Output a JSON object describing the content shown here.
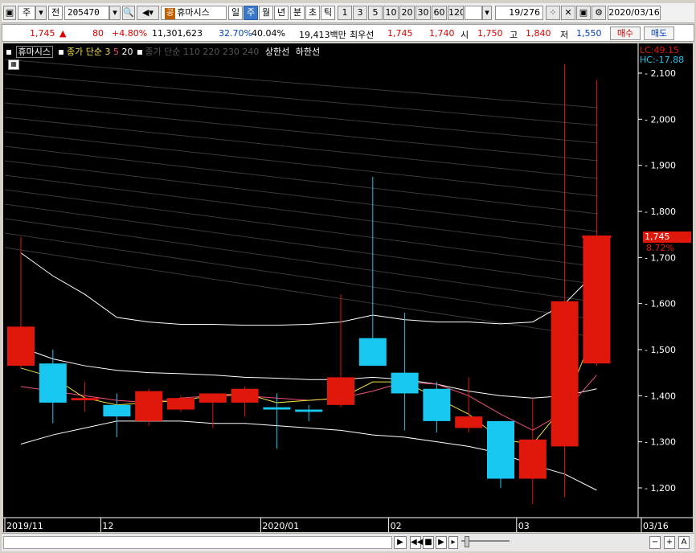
{
  "toolbar": {
    "market": "주",
    "jeon": "전",
    "code": "205470",
    "name_badge": "공",
    "name": "휴마시스",
    "periods": [
      "일",
      "주",
      "월",
      "년"
    ],
    "selected_period": "주",
    "minute_tabs": [
      "분",
      "초",
      "틱"
    ],
    "nums": [
      "1",
      "3",
      "5",
      "10",
      "20",
      "30",
      "60",
      "120"
    ],
    "count": "19",
    "total": "/276",
    "date": "2020/03/16"
  },
  "info": {
    "price": "1,745",
    "arrow": "▲",
    "change": "80",
    "pct": "+4.80%",
    "volume": "11,301,623",
    "vol_ratio": "32.70%",
    "turnover": "40.04%",
    "amount": "19,413백만",
    "best_label": "최우선",
    "ask": "1,745",
    "bid": "1,740",
    "open_label": "시",
    "open": "1,750",
    "high_label": "고",
    "high": "1,840",
    "low_label": "저",
    "low": "1,550",
    "buy": "매수",
    "sell": "매도"
  },
  "legend": {
    "name": "휴마시스",
    "ma_label": "종가 단순 3",
    "ma5": "5",
    "ma20": "20",
    "faded": "종가 단순 110 220 230 240",
    "upper": "상한선",
    "lower": "하한선"
  },
  "overlay": {
    "lc": "LC:49.15",
    "hc": "HC:-17.88",
    "price_tag": "1,745",
    "pct_tag": "8.72%"
  },
  "colors": {
    "up": "#e0180c",
    "down": "#18c8f0",
    "ma3": "#f0e040",
    "ma5": "#f05078",
    "ma20": "#ffffff",
    "axis": "#ffffff"
  },
  "chart_data": {
    "type": "candlestick",
    "yticks": [
      1200,
      1300,
      1400,
      1500,
      1600,
      1700,
      1800,
      1900,
      2000,
      2100
    ],
    "ylim": [
      1165,
      2160
    ],
    "xlabels": [
      {
        "index": 0,
        "label": "2019/11"
      },
      {
        "index": 3,
        "label": "12"
      },
      {
        "index": 8,
        "label": "2020/01"
      },
      {
        "index": 12,
        "label": "02"
      },
      {
        "index": 16,
        "label": "03"
      },
      {
        "index": 19,
        "label": "03/16"
      }
    ],
    "candles": [
      {
        "o": 1465,
        "h": 1745,
        "l": 1460,
        "c": 1550
      },
      {
        "o": 1470,
        "h": 1500,
        "l": 1340,
        "c": 1385
      },
      {
        "o": 1390,
        "h": 1430,
        "l": 1365,
        "c": 1395
      },
      {
        "o": 1380,
        "h": 1405,
        "l": 1310,
        "c": 1355
      },
      {
        "o": 1345,
        "h": 1415,
        "l": 1335,
        "c": 1410
      },
      {
        "o": 1370,
        "h": 1400,
        "l": 1365,
        "c": 1395
      },
      {
        "o": 1385,
        "h": 1405,
        "l": 1330,
        "c": 1405
      },
      {
        "o": 1385,
        "h": 1420,
        "l": 1355,
        "c": 1415
      },
      {
        "o": 1375,
        "h": 1405,
        "l": 1285,
        "c": 1370
      },
      {
        "o": 1370,
        "h": 1380,
        "l": 1345,
        "c": 1365
      },
      {
        "o": 1380,
        "h": 1620,
        "l": 1375,
        "c": 1440
      },
      {
        "o": 1525,
        "h": 1875,
        "l": 1475,
        "c": 1465
      },
      {
        "o": 1450,
        "h": 1580,
        "l": 1325,
        "c": 1405
      },
      {
        "o": 1415,
        "h": 1430,
        "l": 1320,
        "c": 1345
      },
      {
        "o": 1330,
        "h": 1440,
        "l": 1320,
        "c": 1355
      },
      {
        "o": 1345,
        "h": 1345,
        "l": 1200,
        "c": 1220
      },
      {
        "o": 1220,
        "h": 1395,
        "l": 1165,
        "c": 1305
      },
      {
        "o": 1290,
        "h": 2120,
        "l": 1180,
        "c": 1605
      },
      {
        "o": 1470,
        "h": 2085,
        "l": 1465,
        "c": 1745
      }
    ],
    "ma3": [
      1460,
      1440,
      1395,
      1380,
      1385,
      1390,
      1400,
      1405,
      1385,
      1390,
      1395,
      1430,
      1430,
      1395,
      1360,
      1305,
      1295,
      1380,
      1550
    ],
    "ma5": [
      1420,
      1410,
      1400,
      1390,
      1385,
      1395,
      1400,
      1400,
      1395,
      1390,
      1395,
      1410,
      1430,
      1425,
      1400,
      1360,
      1325,
      1365,
      1445
    ],
    "ma20_mid": [
      1505,
      1480,
      1465,
      1455,
      1450,
      1448,
      1445,
      1440,
      1438,
      1435,
      1435,
      1440,
      1435,
      1425,
      1410,
      1400,
      1395,
      1400,
      1415
    ],
    "upper_band": [
      1710,
      1660,
      1620,
      1570,
      1560,
      1555,
      1555,
      1553,
      1553,
      1555,
      1560,
      1575,
      1565,
      1560,
      1560,
      1556,
      1560,
      1600,
      1670
    ],
    "lower_band": [
      1295,
      1315,
      1330,
      1345,
      1345,
      1345,
      1340,
      1340,
      1335,
      1330,
      1325,
      1315,
      1310,
      1300,
      1290,
      1275,
      1250,
      1230,
      1195
    ]
  },
  "bottom": {
    "zoom_in": "+",
    "zoom_out": "−",
    "font_a": "A"
  }
}
